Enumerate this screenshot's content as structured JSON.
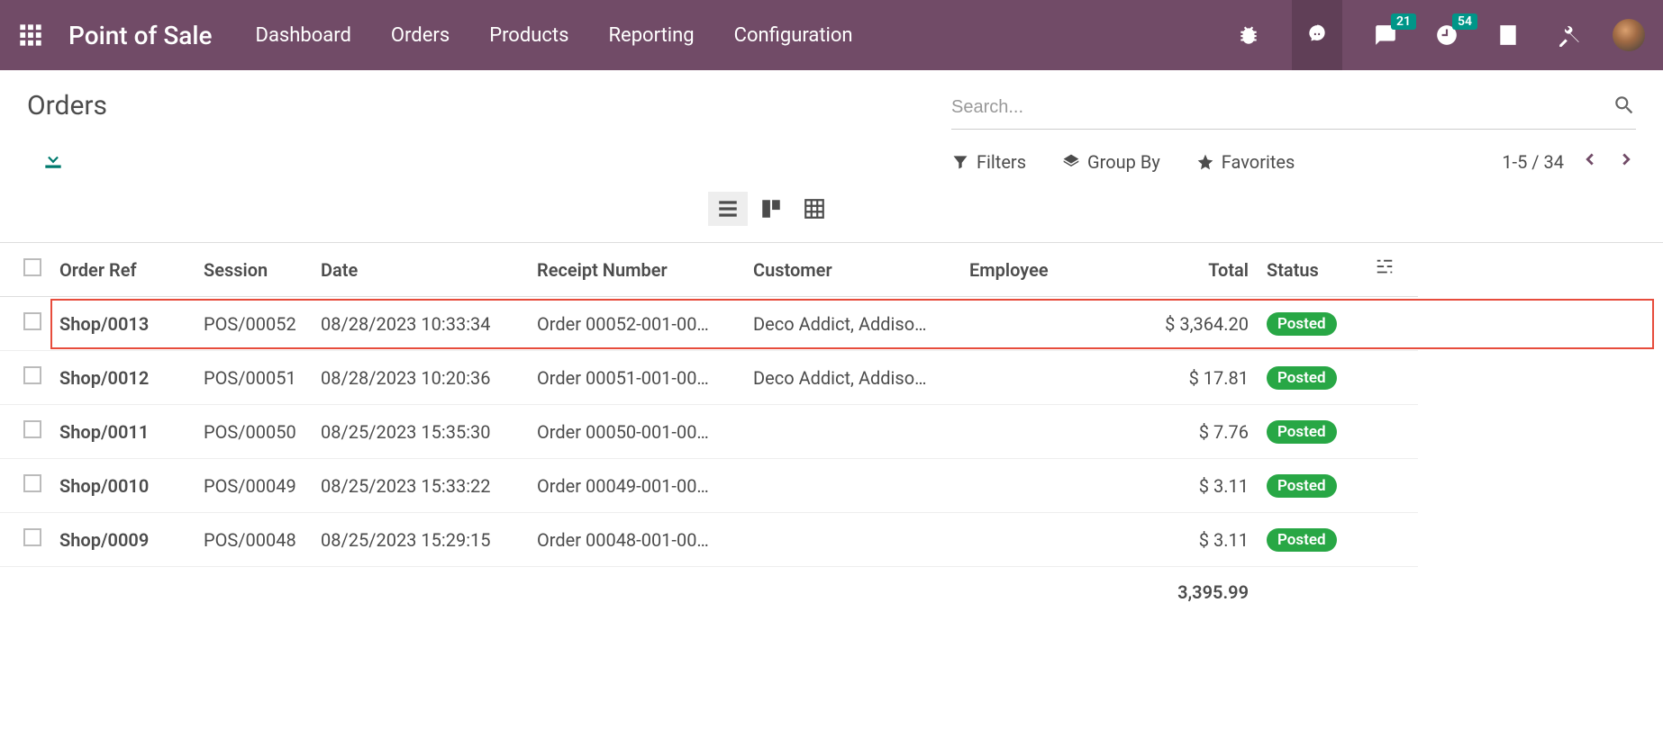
{
  "navbar": {
    "app_title": "Point of Sale",
    "menu": [
      "Dashboard",
      "Orders",
      "Products",
      "Reporting",
      "Configuration"
    ],
    "badges": {
      "messages": "21",
      "activities": "54"
    }
  },
  "page": {
    "title": "Orders",
    "search_placeholder": "Search...",
    "filters_label": "Filters",
    "groupby_label": "Group By",
    "favorites_label": "Favorites",
    "pager": {
      "range": "1-5",
      "total": "34"
    }
  },
  "table": {
    "columns": [
      "Order Ref",
      "Session",
      "Date",
      "Receipt Number",
      "Customer",
      "Employee",
      "Total",
      "Status"
    ],
    "rows": [
      {
        "ref": "Shop/0013",
        "session": "POS/00052",
        "date": "08/28/2023 10:33:34",
        "receipt": "Order 00052-001-00…",
        "customer": "Deco Addict, Addiso…",
        "employee": "",
        "total": "$ 3,364.20",
        "status": "Posted",
        "highlighted": true
      },
      {
        "ref": "Shop/0012",
        "session": "POS/00051",
        "date": "08/28/2023 10:20:36",
        "receipt": "Order 00051-001-00…",
        "customer": "Deco Addict, Addiso…",
        "employee": "",
        "total": "$ 17.81",
        "status": "Posted",
        "highlighted": false
      },
      {
        "ref": "Shop/0011",
        "session": "POS/00050",
        "date": "08/25/2023 15:35:30",
        "receipt": "Order 00050-001-00…",
        "customer": "",
        "employee": "",
        "total": "$ 7.76",
        "status": "Posted",
        "highlighted": false
      },
      {
        "ref": "Shop/0010",
        "session": "POS/00049",
        "date": "08/25/2023 15:33:22",
        "receipt": "Order 00049-001-00…",
        "customer": "",
        "employee": "",
        "total": "$ 3.11",
        "status": "Posted",
        "highlighted": false
      },
      {
        "ref": "Shop/0009",
        "session": "POS/00048",
        "date": "08/25/2023 15:29:15",
        "receipt": "Order 00048-001-00…",
        "customer": "",
        "employee": "",
        "total": "$ 3.11",
        "status": "Posted",
        "highlighted": false
      }
    ],
    "footer_total": "3,395.99"
  }
}
